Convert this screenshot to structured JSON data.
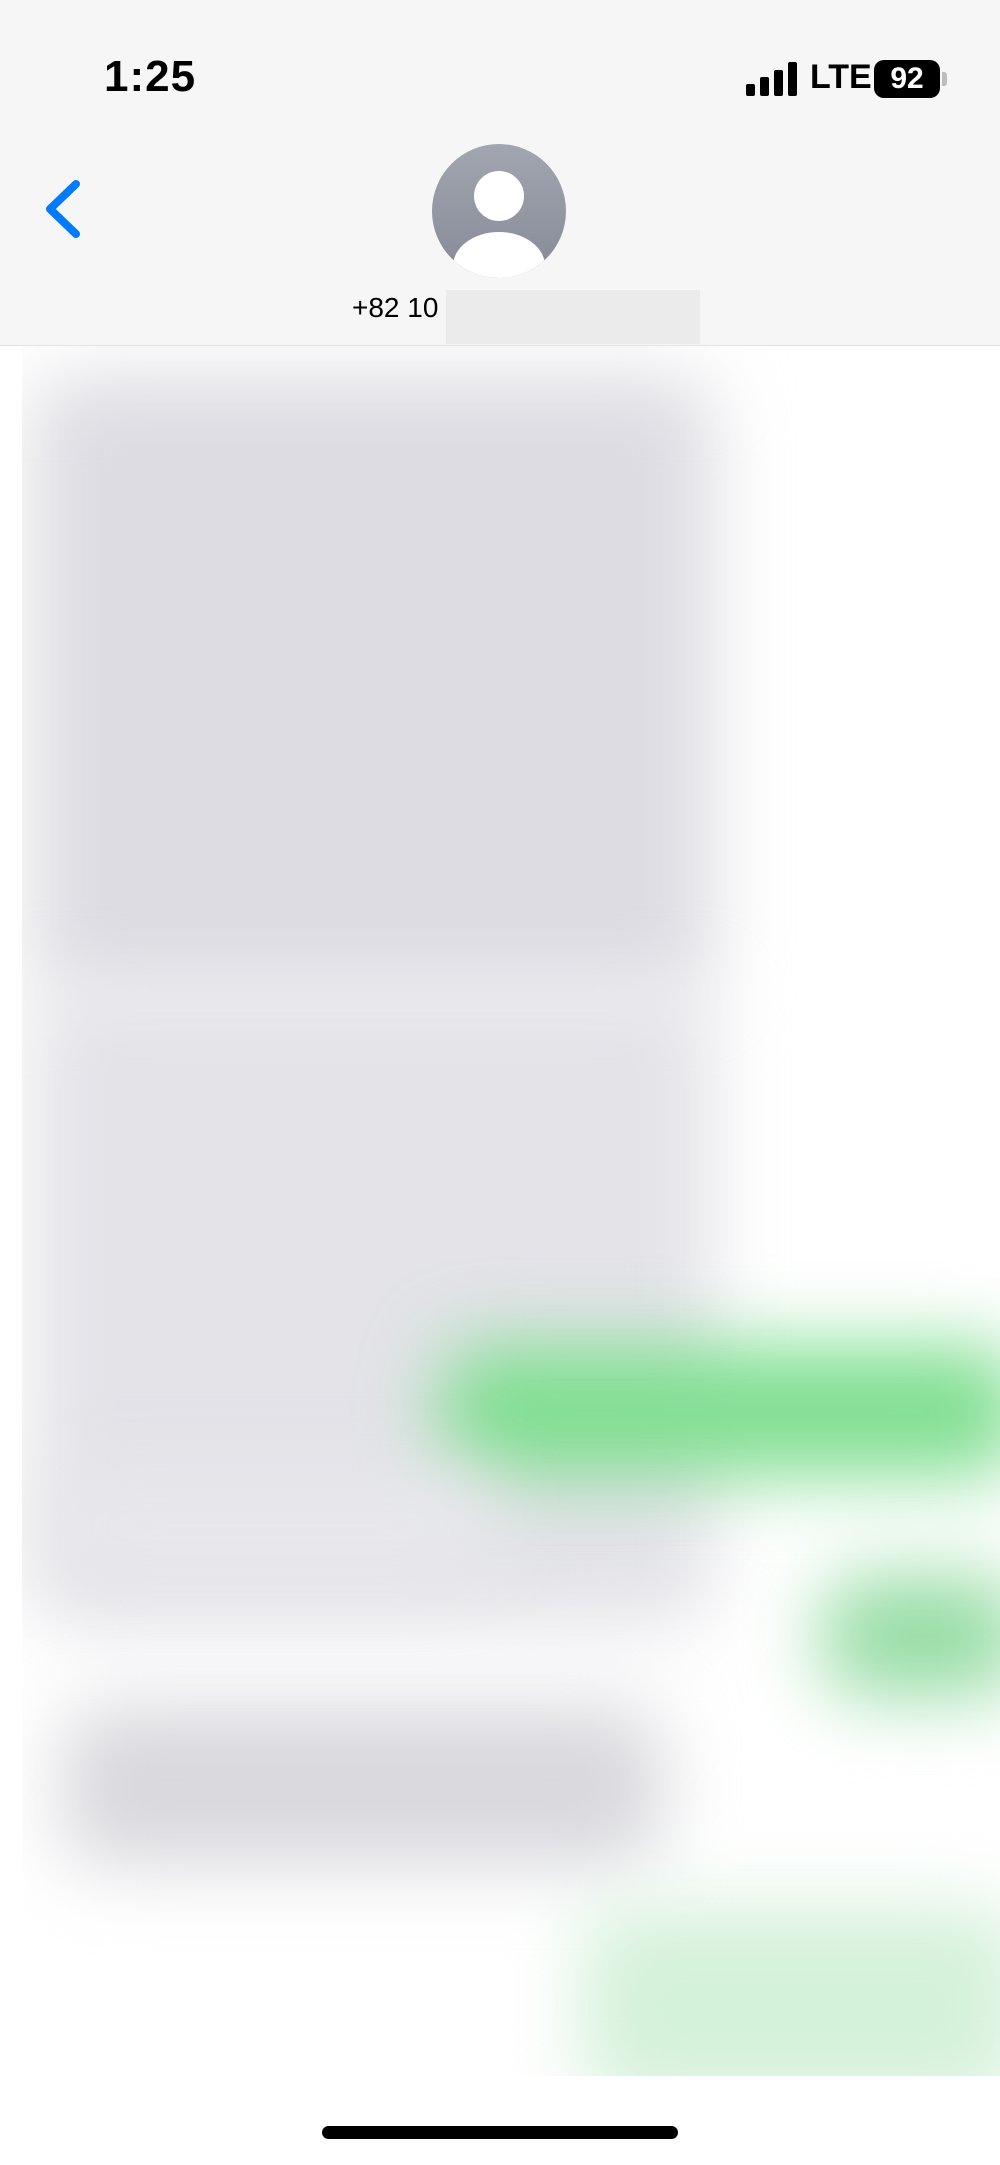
{
  "status_bar": {
    "time": "1:25",
    "network": "LTE",
    "battery_level": "92"
  },
  "header": {
    "back_icon": "chevron-left-icon",
    "avatar_icon": "person-silhouette-icon",
    "contact_number": "+82 10"
  },
  "colors": {
    "accent": "#007AFF",
    "incoming_bubble": "#e5e5ea",
    "outgoing_bubble": "#65d46e"
  }
}
